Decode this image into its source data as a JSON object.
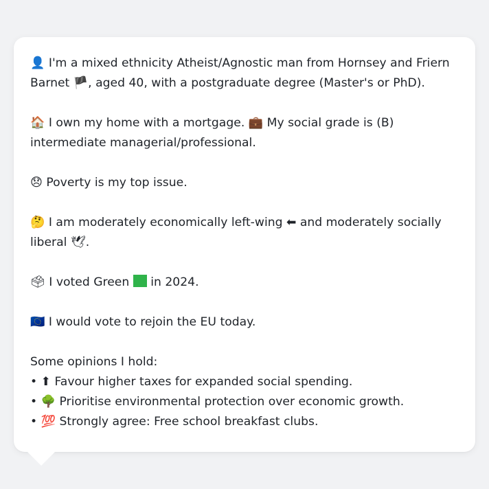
{
  "profile": {
    "identity": {
      "icon": "person-silhouette",
      "text_before_flag": "I'm a mixed ethnicity Atheist/Agnostic man from Hornsey and Friern Barnet",
      "flag_icon": "england-flag",
      "text_after_flag": ", aged 40, with a postgraduate degree (Master's or PhD)."
    },
    "housing": {
      "icon": "house",
      "text": "I own my home with a mortgage.",
      "grade_icon": "briefcase",
      "grade_text": "My social grade is (B) intermediate managerial/professional."
    },
    "issue": {
      "icon": "disappointed-face",
      "text": "Poverty is my top issue."
    },
    "ideology": {
      "icon": "thinking-face",
      "text_before": "I am moderately economically left-wing",
      "left_icon": "left-arrow",
      "text_middle": "and moderately socially liberal",
      "dove_icon": "dove",
      "text_after": "."
    },
    "vote": {
      "icon": "ballot-box",
      "text_before": "I voted Green",
      "party_icon": "green-square",
      "party_color": "#2fb34a",
      "text_after": "in 2024."
    },
    "eu": {
      "icon": "eu-flag",
      "text": "I would vote to rejoin the EU today."
    },
    "opinions_heading": "Some opinions I hold:",
    "opinions": [
      {
        "bullet": "•",
        "icon": "up-arrow",
        "text": "Favour higher taxes for expanded social spending."
      },
      {
        "bullet": "•",
        "icon": "deciduous-tree",
        "text": "Prioritise environmental protection over economic growth."
      },
      {
        "bullet": "•",
        "icon": "hundred-points",
        "text": "Strongly agree: Free school breakfast clubs."
      }
    ]
  }
}
